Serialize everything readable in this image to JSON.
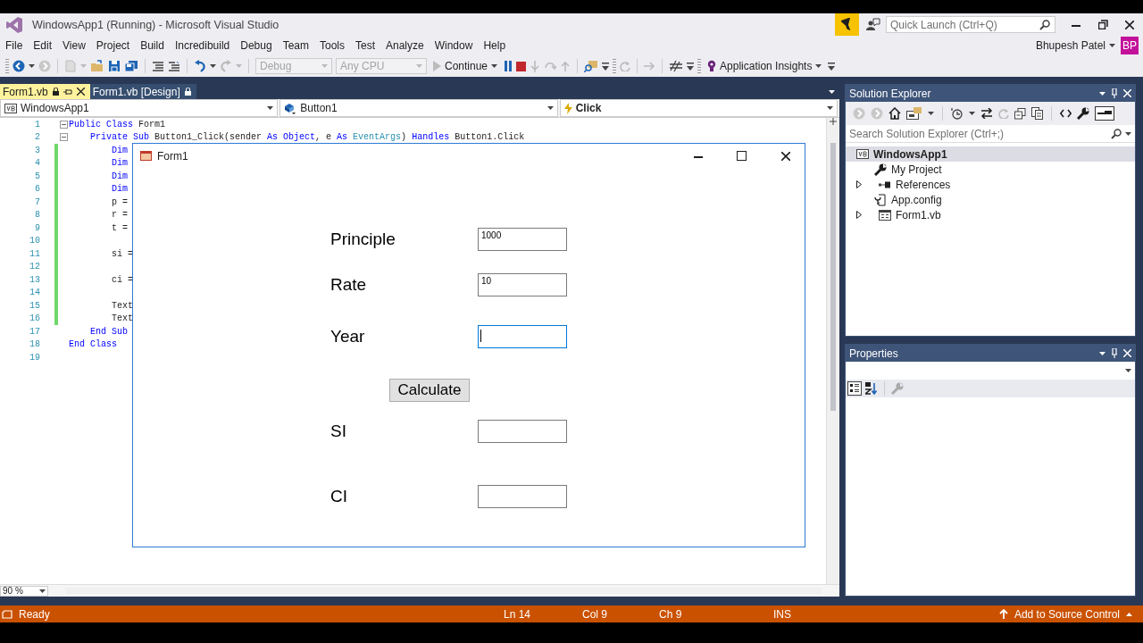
{
  "window": {
    "title": "WindowsApp1 (Running) - Microsoft Visual Studio"
  },
  "quick_launch": {
    "placeholder": "Quick Launch (Ctrl+Q)"
  },
  "account": {
    "name": "Bhupesh Patel",
    "initials": "BP"
  },
  "menu": [
    "File",
    "Edit",
    "View",
    "Project",
    "Build",
    "Incredibuild",
    "Debug",
    "Team",
    "Tools",
    "Test",
    "Analyze",
    "Window",
    "Help"
  ],
  "toolbar": {
    "configuration": {
      "value": "Debug",
      "disabled": true
    },
    "platform": {
      "value": "Any CPU",
      "disabled": true
    },
    "continue_button": "Continue",
    "insights_button": "Application Insights"
  },
  "document_tabs": [
    {
      "label": "Form1.vb",
      "selected": true
    },
    {
      "label": "Form1.vb [Design]",
      "selected": false
    }
  ],
  "navigation_bar": {
    "project": "WindowsApp1",
    "object": "Button1",
    "event": "Click"
  },
  "code_lines": [
    {
      "number": "1",
      "changed": false,
      "fold": true,
      "tokens": [
        {
          "kind": "keyword",
          "text": "Public Class "
        },
        {
          "kind": "plain",
          "text": "Form1"
        }
      ]
    },
    {
      "number": "2",
      "changed": false,
      "fold": true,
      "tokens": [
        {
          "kind": "keyword",
          "text": "    Private Sub "
        },
        {
          "kind": "plain",
          "text": "Button1_Click(sender "
        },
        {
          "kind": "keyword",
          "text": "As Object"
        },
        {
          "kind": "plain",
          "text": ", e "
        },
        {
          "kind": "keyword",
          "text": "As "
        },
        {
          "kind": "type",
          "text": "EventArgs"
        },
        {
          "kind": "plain",
          "text": ") "
        },
        {
          "kind": "keyword",
          "text": "Handles "
        },
        {
          "kind": "plain",
          "text": "Button1.Click"
        }
      ]
    },
    {
      "number": "3",
      "changed": true,
      "fold": false,
      "tokens": [
        {
          "kind": "keyword",
          "text": "        Dim"
        }
      ]
    },
    {
      "number": "4",
      "changed": true,
      "fold": false,
      "tokens": [
        {
          "kind": "keyword",
          "text": "        Dim"
        }
      ]
    },
    {
      "number": "5",
      "changed": true,
      "fold": false,
      "tokens": [
        {
          "kind": "keyword",
          "text": "        Dim"
        }
      ]
    },
    {
      "number": "6",
      "changed": true,
      "fold": false,
      "tokens": [
        {
          "kind": "keyword",
          "text": "        Dim"
        }
      ]
    },
    {
      "number": "7",
      "changed": true,
      "fold": false,
      "tokens": [
        {
          "kind": "plain",
          "text": "        p ="
        }
      ]
    },
    {
      "number": "8",
      "changed": true,
      "fold": false,
      "tokens": [
        {
          "kind": "plain",
          "text": "        r ="
        }
      ]
    },
    {
      "number": "9",
      "changed": true,
      "fold": false,
      "tokens": [
        {
          "kind": "plain",
          "text": "        t ="
        }
      ]
    },
    {
      "number": "10",
      "changed": true,
      "fold": false
    },
    {
      "number": "11",
      "changed": true,
      "fold": false,
      "tokens": [
        {
          "kind": "plain",
          "text": "        si ="
        }
      ]
    },
    {
      "number": "12",
      "changed": true,
      "fold": false
    },
    {
      "number": "13",
      "changed": true,
      "fold": false,
      "tokens": [
        {
          "kind": "plain",
          "text": "        ci ="
        }
      ]
    },
    {
      "number": "14",
      "changed": true,
      "fold": false
    },
    {
      "number": "15",
      "changed": true,
      "fold": false,
      "tokens": [
        {
          "kind": "plain",
          "text": "        Text"
        }
      ]
    },
    {
      "number": "16",
      "changed": true,
      "fold": false,
      "tokens": [
        {
          "kind": "plain",
          "text": "        Text"
        }
      ]
    },
    {
      "number": "17",
      "changed": false,
      "fold": false,
      "tokens": [
        {
          "kind": "keyword",
          "text": "    End Sub"
        }
      ]
    },
    {
      "number": "18",
      "changed": false,
      "fold": false,
      "tokens": [
        {
          "kind": "keyword",
          "text": "End Class"
        }
      ]
    },
    {
      "number": "19",
      "changed": false,
      "fold": false
    }
  ],
  "zoom": "90 %",
  "running_form": {
    "title": "Form1",
    "rows": [
      {
        "kind": "field",
        "label": "Principle",
        "value": "1000",
        "focused": false
      },
      {
        "kind": "field",
        "label": "Rate",
        "value": "10",
        "focused": false
      },
      {
        "kind": "field",
        "label": "Year",
        "focused": true
      },
      {
        "kind": "button",
        "label": "Calculate"
      },
      {
        "kind": "field",
        "label": "SI",
        "focused": false
      },
      {
        "kind": "field",
        "label": "CI",
        "focused": false
      }
    ]
  },
  "solution_explorer": {
    "title": "Solution Explorer",
    "search": {
      "placeholder": "Search Solution Explorer (Ctrl+;)"
    },
    "tree": [
      {
        "label": "WindowsApp1",
        "kind": "project",
        "selected": true,
        "children": [
          {
            "label": "My Project",
            "kind": "settings",
            "selected": false,
            "expandable": false
          },
          {
            "label": "References",
            "kind": "references",
            "selected": false,
            "expandable": true
          },
          {
            "label": "App.config",
            "kind": "config",
            "selected": false,
            "expandable": false
          },
          {
            "label": "Form1.vb",
            "kind": "form",
            "selected": false,
            "expandable": true
          }
        ]
      }
    ]
  },
  "properties": {
    "title": "Properties"
  },
  "status_bar": {
    "state": "Ready",
    "line": "Ln 14",
    "column": "Col 9",
    "character": "Ch 9",
    "mode": "INS",
    "source_control": "Add to Source Control"
  }
}
